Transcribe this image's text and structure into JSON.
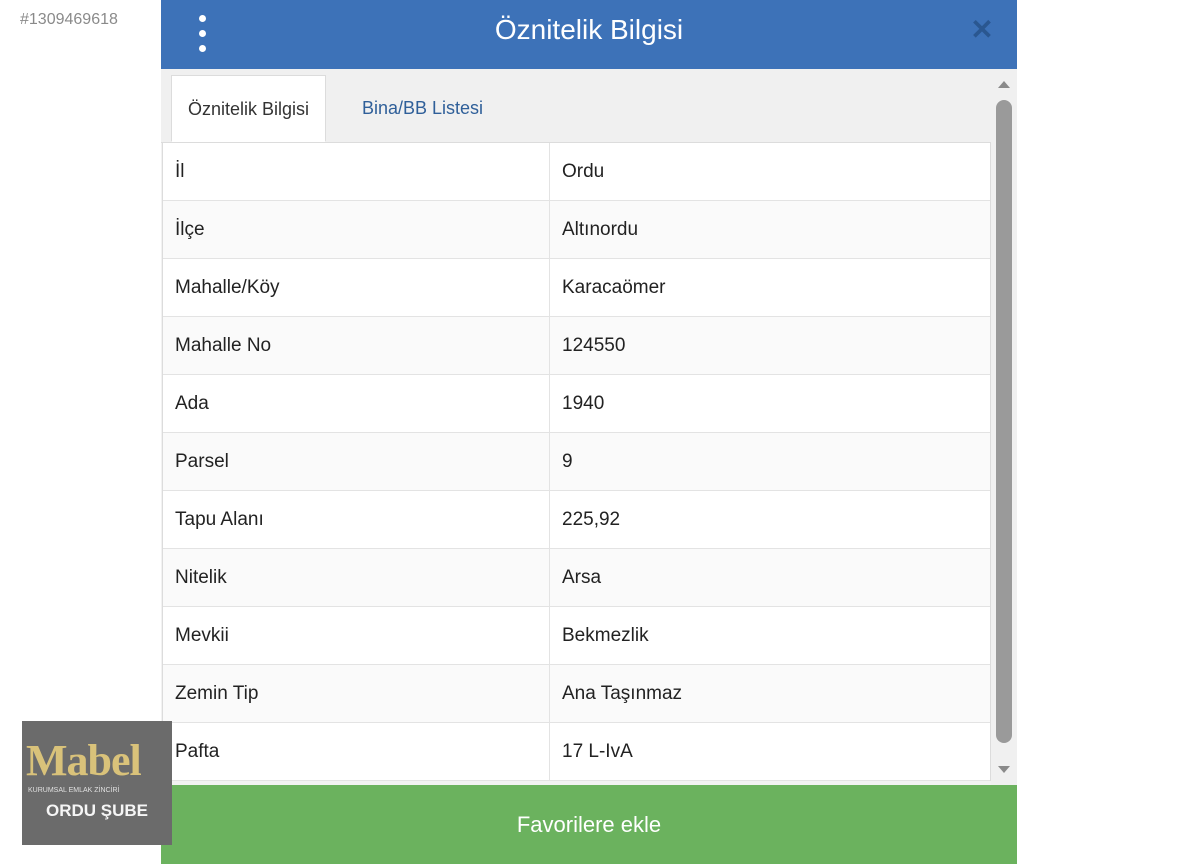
{
  "listing_id": "#1309469618",
  "dialog": {
    "title": "Öznitelik Bilgisi",
    "close_label": "✕"
  },
  "tabs": [
    {
      "label": "Öznitelik Bilgisi",
      "active": true
    },
    {
      "label": "Bina/BB Listesi",
      "active": false
    }
  ],
  "attributes": [
    {
      "label": "İl",
      "value": "Ordu"
    },
    {
      "label": "İlçe",
      "value": "Altınordu"
    },
    {
      "label": "Mahalle/Köy",
      "value": "Karacaömer"
    },
    {
      "label": "Mahalle No",
      "value": "124550"
    },
    {
      "label": "Ada",
      "value": "1940"
    },
    {
      "label": "Parsel",
      "value": "9"
    },
    {
      "label": "Tapu Alanı",
      "value": "225,92"
    },
    {
      "label": "Nitelik",
      "value": "Arsa"
    },
    {
      "label": "Mevkii",
      "value": "Bekmezlik"
    },
    {
      "label": "Zemin Tip",
      "value": "Ana Taşınmaz"
    },
    {
      "label": "Pafta",
      "value": "17 L-IvA"
    }
  ],
  "footer": {
    "add_favorites_label": "Favorilere ekle"
  },
  "watermark": {
    "brand": "Mabel",
    "tagline": "KURUMSAL EMLAK ZİNCİRİ",
    "branch": "ORDU ŞUBE"
  },
  "colors": {
    "header": "#3d72b8",
    "footer_button": "#6bb25e",
    "tab_inactive_text": "#2f5f99"
  }
}
